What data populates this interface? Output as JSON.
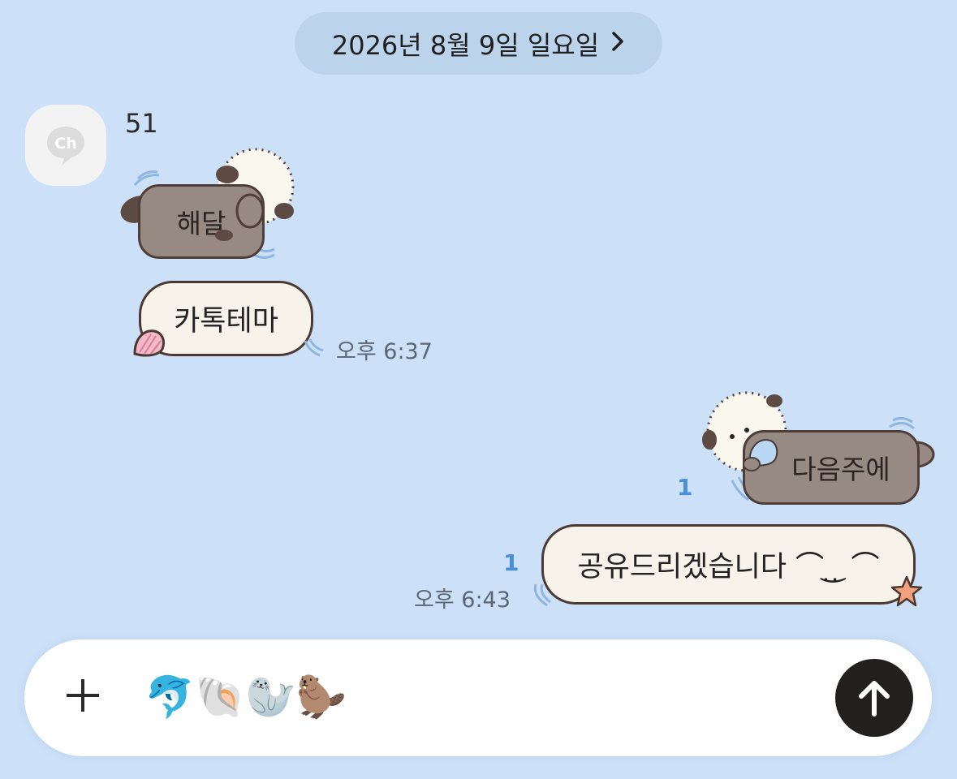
{
  "date_header": {
    "label": "2026년 8월 9일 일요일",
    "chevron": "›"
  },
  "incoming": {
    "avatar": {
      "icon": "ch-logo-icon",
      "text": "Ch"
    },
    "sender_name": "51",
    "messages": [
      {
        "text": "해달",
        "style": "otter-sticker"
      },
      {
        "text": "카톡테마",
        "style": "cream-bubble"
      }
    ],
    "time": "오후 6:37"
  },
  "outgoing": {
    "messages": [
      {
        "text": "다음주에",
        "style": "otter-sticker",
        "unread": "1"
      },
      {
        "text": "공유드리겠습니다 ᵔ̤ ᴥ ᵔ̤",
        "display": "공유드리겠습니다 ⌒ ̣͜ ̣ ⌒",
        "style": "cream-bubble",
        "unread": "1"
      }
    ],
    "time": "오후 6:43"
  },
  "composer": {
    "plus_icon": "plus-icon",
    "emoji_input": "🐬🐚🦭🦫",
    "send_icon": "arrow-up-icon"
  },
  "colors": {
    "background": "#cce0f8",
    "date_pill": "#bcd3ec",
    "otter_bubble": "#978a82",
    "cream_bubble": "#f7f2ea",
    "read_count": "#4a90d6",
    "send_button": "#231f1e"
  }
}
